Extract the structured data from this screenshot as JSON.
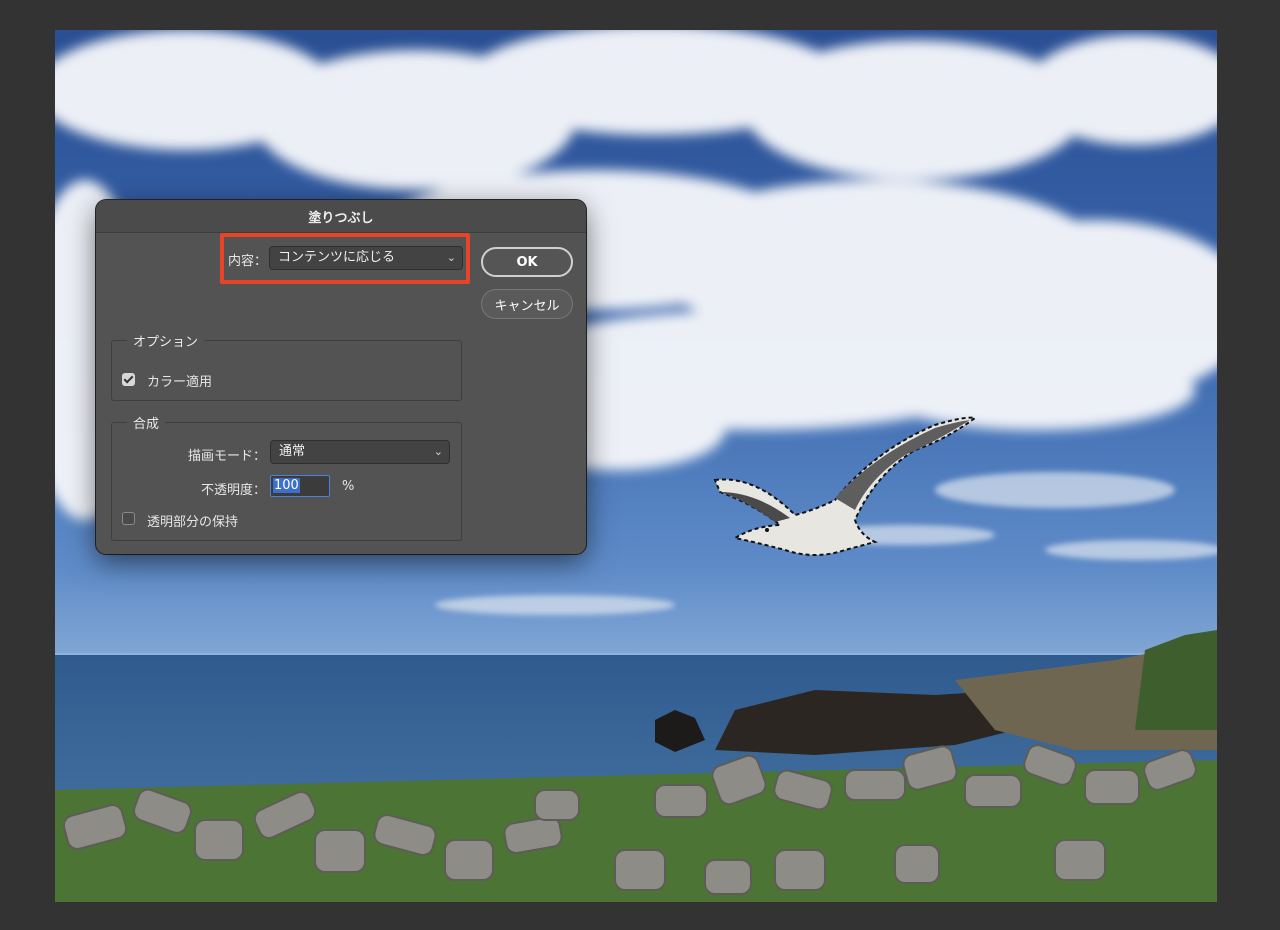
{
  "dialog": {
    "title": "塗りつぶし",
    "content_label": "内容：",
    "content_value": "コンテンツに応じる",
    "ok_label": "OK",
    "cancel_label": "キャンセル",
    "options_group": {
      "title": "オプション",
      "color_adapt_label": "カラー適用",
      "color_adapt_checked": true
    },
    "blend_group": {
      "title": "合成",
      "mode_label": "描画モード：",
      "mode_value": "通常",
      "opacity_label": "不透明度：",
      "opacity_value": "100",
      "opacity_unit": "%",
      "preserve_label": "透明部分の保持",
      "preserve_checked": false
    }
  },
  "icons": {
    "dropdown": "chevron-down-icon",
    "checkbox": "checkbox-icon"
  },
  "colors": {
    "highlight": "#e84427",
    "dialog_bg": "#535353",
    "app_bg": "#333333"
  }
}
